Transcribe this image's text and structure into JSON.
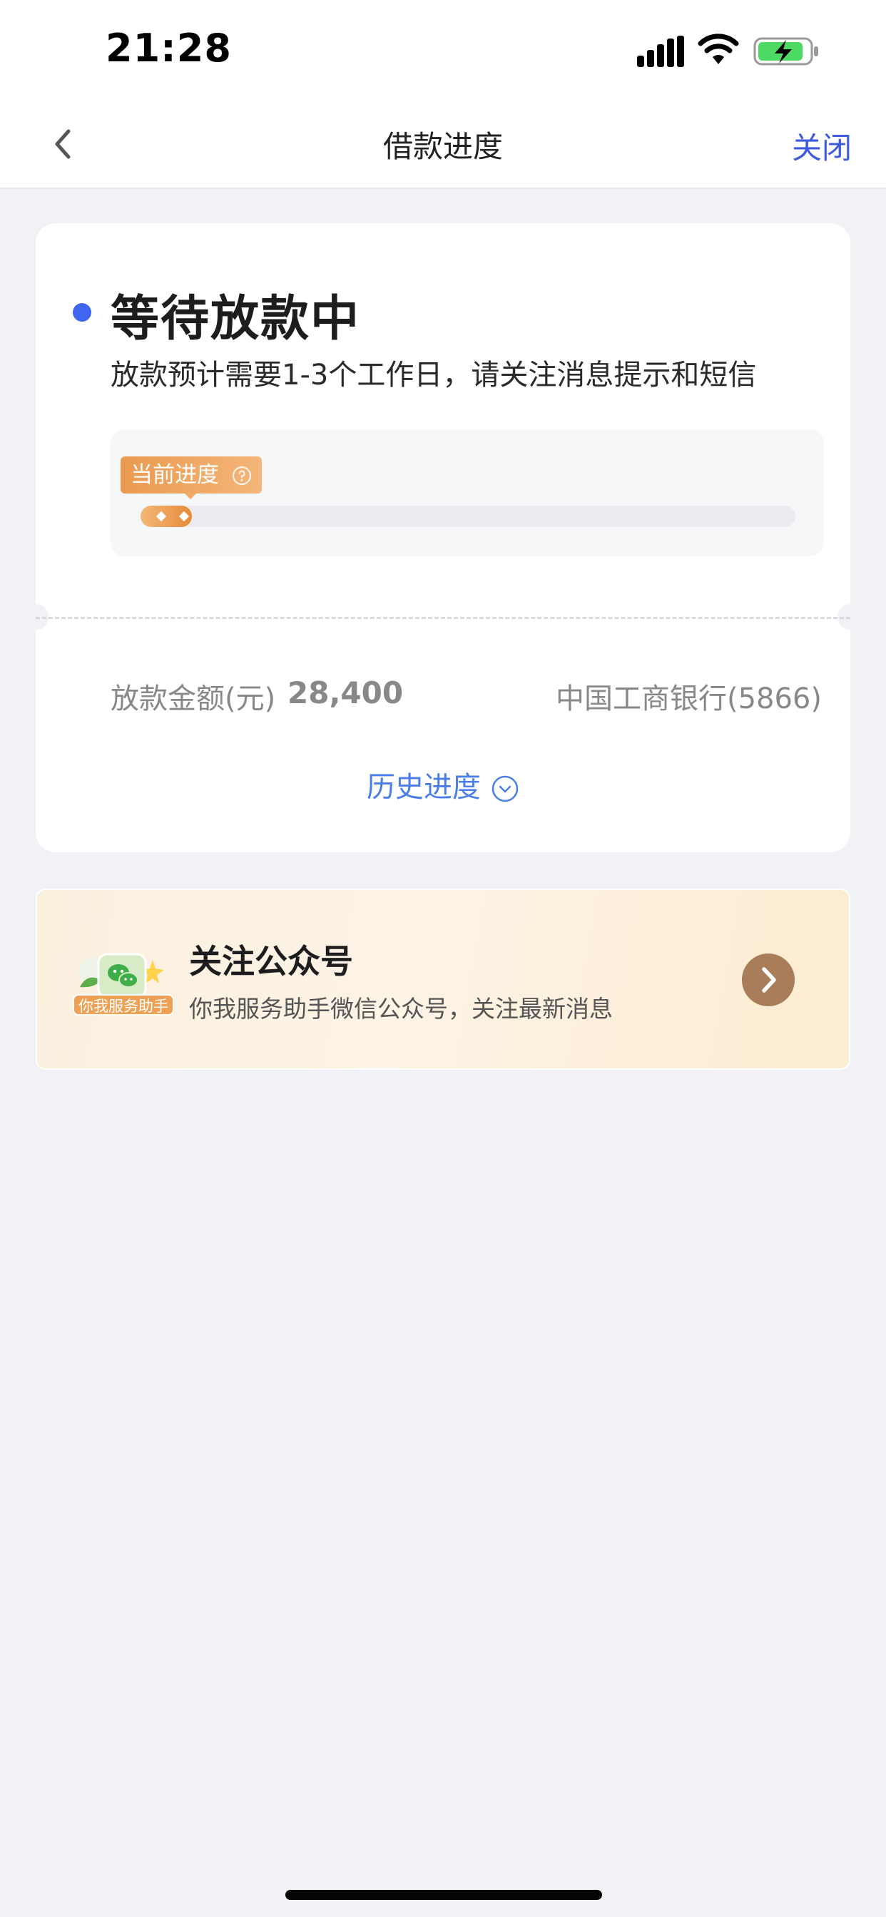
{
  "status_bar": {
    "time": "21:28",
    "icons": [
      "signal-icon",
      "wifi-icon",
      "battery-charging-icon"
    ]
  },
  "nav": {
    "title": "借款进度",
    "close": "关闭",
    "back_icon": "chevron-left-icon"
  },
  "status": {
    "title": "等待放款中",
    "description": "放款预计需要1-3个工作日，请关注消息提示和短信",
    "progress_tag": "当前进度",
    "progress_fraction": 0.05
  },
  "loan": {
    "amount_label": "放款金额(元)",
    "amount_value": "28,400",
    "bank": "中国工商银行(5866)"
  },
  "history": {
    "label": "历史进度"
  },
  "promo": {
    "title": "关注公众号",
    "subtitle": "你我服务助手微信公众号，关注最新消息",
    "badge": "你我服务助手"
  },
  "colors": {
    "accent_blue": "#3e66ee",
    "link_blue": "#4a7ee8",
    "progress_orange": "#e88a3b",
    "promo_arrow": "#a97c5a"
  }
}
